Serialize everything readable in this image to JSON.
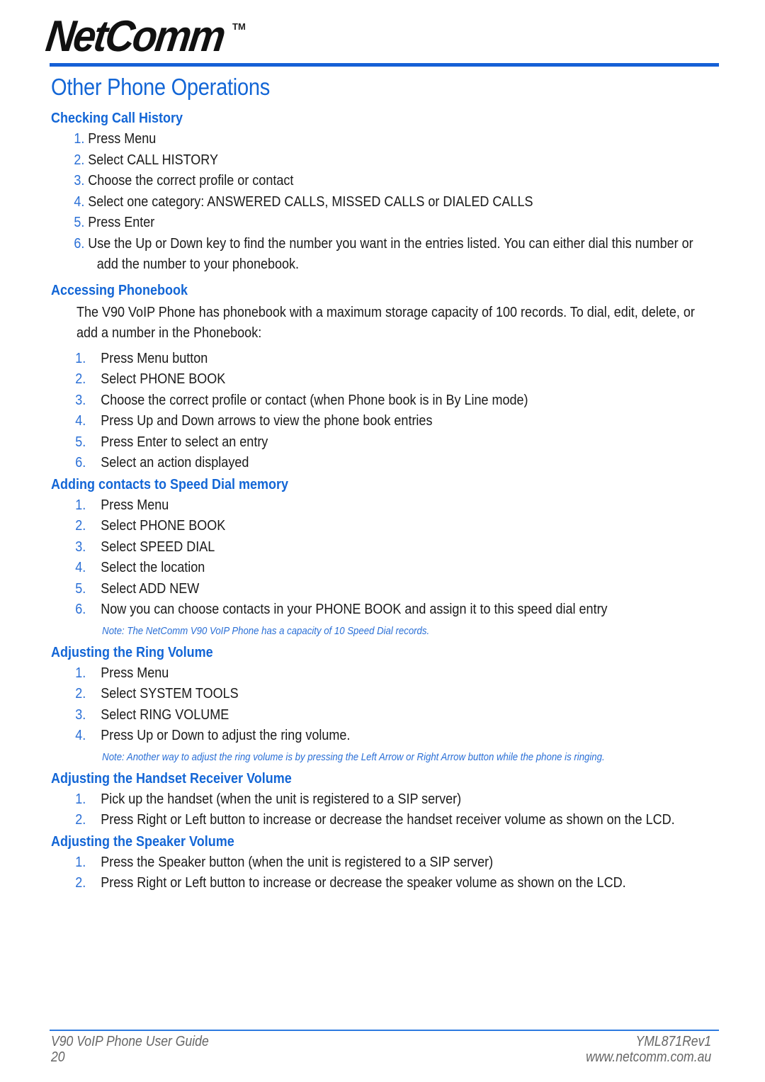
{
  "header": {
    "logo_text": "NetComm",
    "logo_tm": "TM",
    "page_title": "Other Phone Operations"
  },
  "sections": [
    {
      "heading": "Checking Call History",
      "steps": [
        {
          "num": "1.",
          "text": "Press Menu"
        },
        {
          "num": "2.",
          "text": "Select CALL HISTORY"
        },
        {
          "num": "3.",
          "text": "Choose the correct profile or contact"
        },
        {
          "num": "4.",
          "text": "Select one category: ANSWERED CALLS, MISSED CALLS or DIALED CALLS"
        },
        {
          "num": "5.",
          "text": "Press Enter"
        },
        {
          "num": "6.",
          "text": "Use the Up or Down key to find the number you want in the entries listed. You can either dial this number or",
          "cont": "add the number to your phonebook."
        }
      ]
    },
    {
      "heading": "Accessing Phonebook",
      "intro_line1": "The V90 VoIP Phone has phonebook with a maximum storage capacity of 100 records. To dial, edit, delete, or",
      "intro_line2": "add a number in the Phonebook:",
      "steps": [
        {
          "num": "1.",
          "text": "Press Menu button"
        },
        {
          "num": "2.",
          "text": "Select PHONE BOOK"
        },
        {
          "num": "3.",
          "text": "Choose the correct profile or contact (when Phone book is in By Line mode)"
        },
        {
          "num": "4.",
          "text": "Press Up and Down arrows to view the phone book entries"
        },
        {
          "num": "5.",
          "text": "Press Enter to select an entry"
        },
        {
          "num": "6.",
          "text": "Select an action displayed"
        }
      ]
    },
    {
      "heading": "Adding contacts to Speed Dial memory",
      "steps": [
        {
          "num": "1.",
          "text": "Press Menu"
        },
        {
          "num": "2.",
          "text": "Select PHONE BOOK"
        },
        {
          "num": "3.",
          "text": "Select SPEED DIAL"
        },
        {
          "num": "4.",
          "text": "Select the location"
        },
        {
          "num": "5.",
          "text": "Select ADD NEW"
        },
        {
          "num": "6.",
          "text": "Now you can choose contacts in your PHONE BOOK and assign it to this speed dial entry"
        }
      ],
      "note": "Note: The NetComm V90 VoIP Phone has a capacity of 10 Speed Dial records."
    },
    {
      "heading": "Adjusting the Ring Volume",
      "steps": [
        {
          "num": "1.",
          "text": "Press Menu"
        },
        {
          "num": "2.",
          "text": "Select SYSTEM TOOLS"
        },
        {
          "num": "3.",
          "text": "Select RING VOLUME"
        },
        {
          "num": "4.",
          "text": "Press Up or Down to adjust the ring volume."
        }
      ],
      "note": "Note: Another way to adjust the ring volume is by pressing the Left Arrow or Right Arrow button while the phone is ringing."
    },
    {
      "heading": "Adjusting the Handset Receiver Volume",
      "steps": [
        {
          "num": "1.",
          "text": "Pick up the handset (when the unit is registered to a SIP server)"
        },
        {
          "num": "2.",
          "text": "Press Right or Left button to increase or decrease the handset receiver volume as shown on the LCD."
        }
      ]
    },
    {
      "heading": "Adjusting the Speaker Volume",
      "steps": [
        {
          "num": "1.",
          "text": "Press the Speaker button (when the unit is registered to a SIP server)"
        },
        {
          "num": "2.",
          "text": "Press Right or Left button to increase or decrease the speaker volume as shown on the LCD."
        }
      ]
    }
  ],
  "footer": {
    "guide_title": "V90 VoIP Phone User Guide",
    "page_number": "20",
    "doc_code": "YML871Rev1",
    "website": "www.netcomm.com.au"
  },
  "colors": {
    "accent_blue": "#1366d6",
    "rule_blue": "#1560d6",
    "footer_gray": "#666666"
  }
}
